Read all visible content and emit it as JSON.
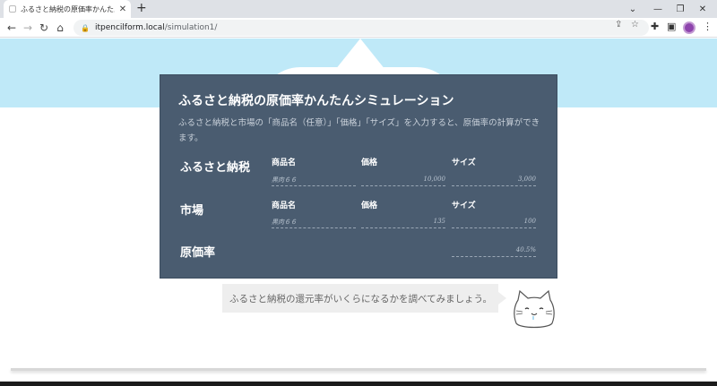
{
  "browser": {
    "tab_title": "ふるさと納税の原価率かんたんシミュ",
    "url_host": "itpencilform.local",
    "url_path": "/simulation1/"
  },
  "card": {
    "title": "ふるさと納税の原価率かんたんシミュレーション",
    "description": "ふるさと納税と市場の「商品名（任意）」「価格」「サイズ」を入力すると、原価率の計算ができます。"
  },
  "columns": {
    "name": "商品名",
    "price": "価格",
    "size": "サイズ"
  },
  "rows": {
    "furusato": {
      "label": "ふるさと納税",
      "name_placeholder": "黒肉６６",
      "price": "10,000",
      "size": "3,000"
    },
    "market": {
      "label": "市場",
      "name_placeholder": "黒肉６６",
      "price": "135",
      "size": "100"
    },
    "result": {
      "label": "原価率",
      "value": "40.5%"
    }
  },
  "bubble": {
    "text": "ふるさと納税の還元率がいくらになるかを調べてみましょう。"
  }
}
